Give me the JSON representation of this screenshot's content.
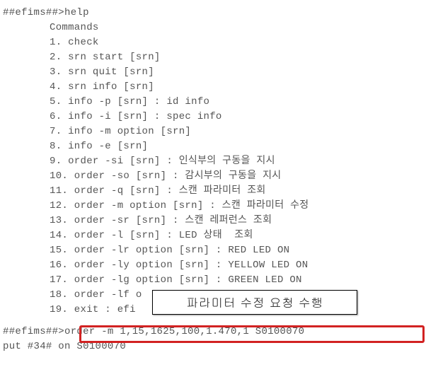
{
  "prompt1": "##efims##>help",
  "commands_heading": "Commands",
  "cmds": {
    "c1": "1. check",
    "c2": "2. srn start [srn]",
    "c3": "3. srn quit [srn]",
    "c4": "4. srn info [srn]",
    "c5": "5. info -p [srn] : id info",
    "c6": "6. info -i [srn] : spec info",
    "c7": "7. info -m option [srn]",
    "c8": "8. info -e [srn]",
    "c9": "9. order -si [srn] : 인식부의 구동을 지시",
    "c10": "10. order -so [srn] : 감시부의 구동을 지시",
    "c11": "11. order -q [srn] : 스캔 파라미터 조회",
    "c12": "12. order -m option [srn] : 스캔 파라미터 수정",
    "c13": "13. order -sr [srn] : 스캔 레퍼런스 조회",
    "c14": "14. order -l [srn] : LED 상태  조회",
    "c15": "15. order -lr option [srn] : RED LED ON",
    "c16": "16. order -ly option [srn] : YELLOW LED ON",
    "c17": "17. order -lg option [srn] : GREEN LED ON",
    "c18": "18. order -lf o",
    "c19": "19. exit : efi"
  },
  "annotation": "파라미터 수정 요청 수행",
  "prompt2": "##efims##>order -m 1,15,1625,100,1.470,1 S0100070",
  "output_line": "put #34# on S0100070"
}
